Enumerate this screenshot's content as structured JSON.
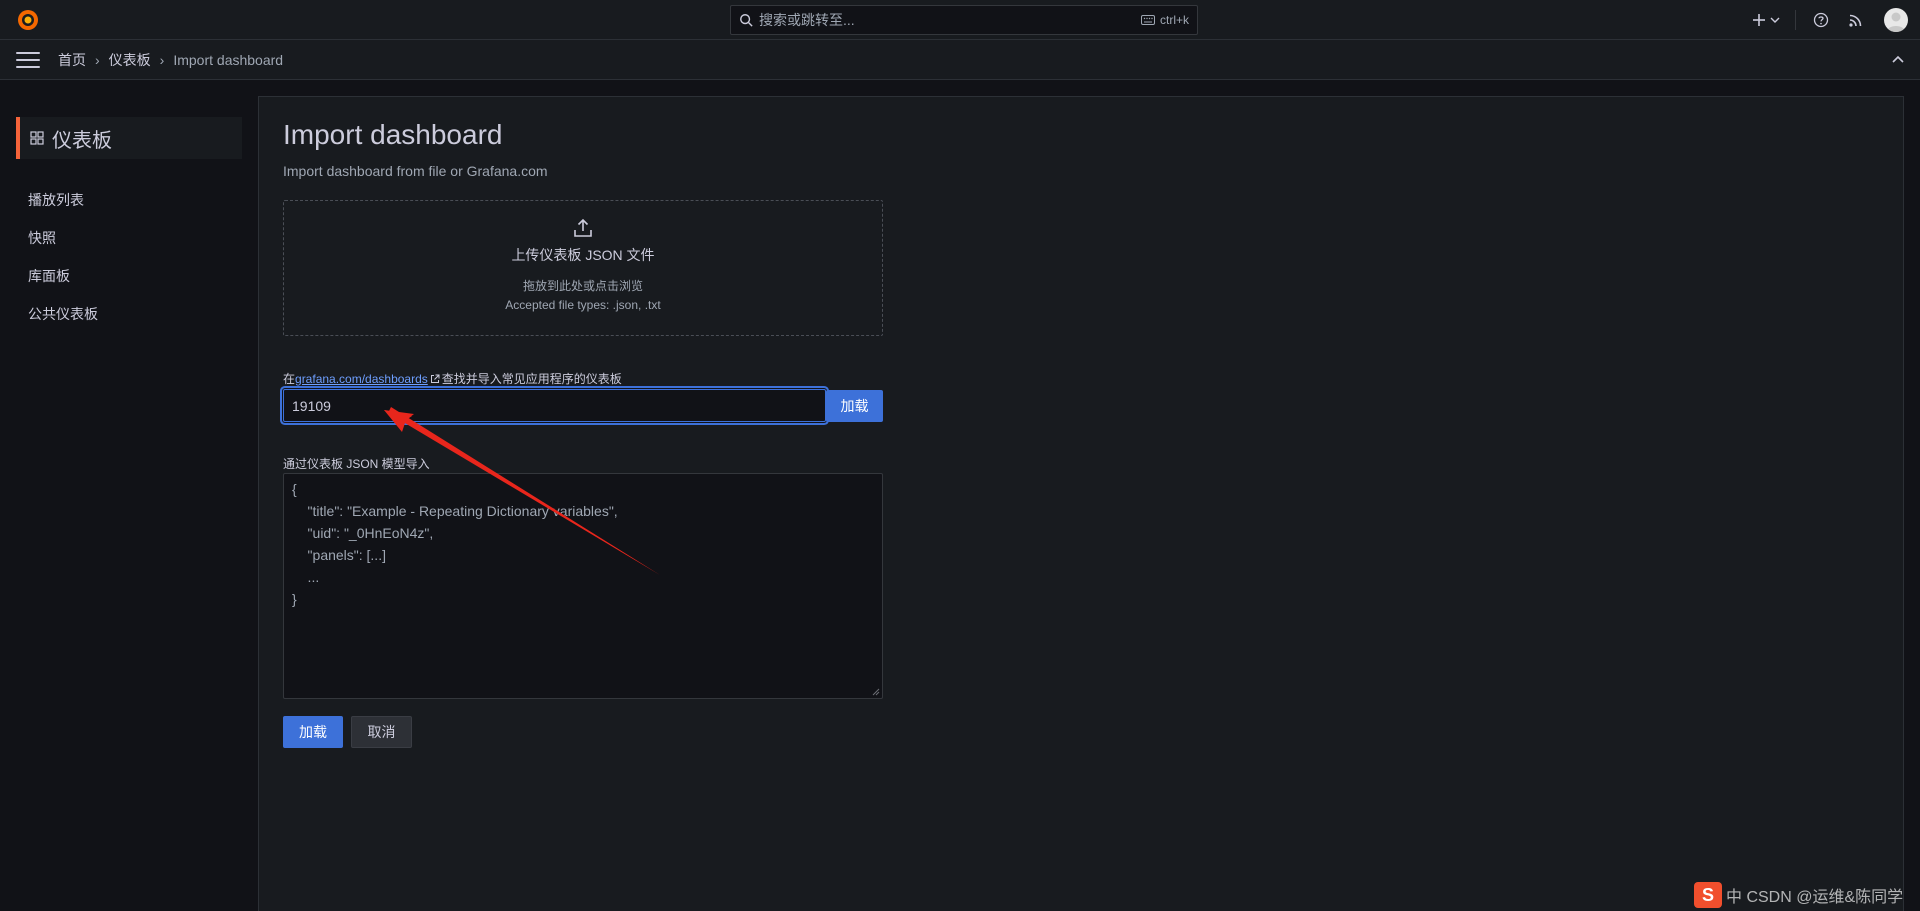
{
  "topbar": {
    "search_placeholder": "搜索或跳转至...",
    "search_shortcut": "ctrl+k",
    "new_icon": "plus-icon",
    "help_icon": "help-icon",
    "news_icon": "rss-icon"
  },
  "breadcrumb": {
    "items": [
      "首页",
      "仪表板",
      "Import dashboard"
    ],
    "separator": "›"
  },
  "sidebar": {
    "header": "仪表板",
    "items": [
      {
        "label": "播放列表"
      },
      {
        "label": "快照"
      },
      {
        "label": "库面板"
      },
      {
        "label": "公共仪表板"
      }
    ]
  },
  "main": {
    "title": "Import dashboard",
    "subtitle": "Import dashboard from file or Grafana.com",
    "upload": {
      "title": "上传仪表板 JSON 文件",
      "hint": "拖放到此处或点击浏览",
      "types": "Accepted file types: .json, .txt"
    },
    "grafana_com": {
      "prefix": "在",
      "link": "grafana.com/dashboards",
      "suffix": "查找并导入常见应用程序的仪表板",
      "value": "19109",
      "load_label": "加载"
    },
    "json_model": {
      "label": "通过仪表板 JSON 模型导入",
      "lines": [
        "{",
        "    \"title\": \"Example - Repeating Dictionary variables\",",
        "    \"uid\": \"_0HnEoN4z\",",
        "    \"panels\": [...]",
        "    ...",
        "}"
      ]
    },
    "buttons": {
      "load": "加载",
      "cancel": "取消"
    }
  },
  "watermark": {
    "logo": "S",
    "text": "中 CSDN @运维&陈同学"
  },
  "colors": {
    "accent": "#3d71d9",
    "brand_orange": "#f5633a",
    "annotation_arrow": "#e8261c"
  }
}
